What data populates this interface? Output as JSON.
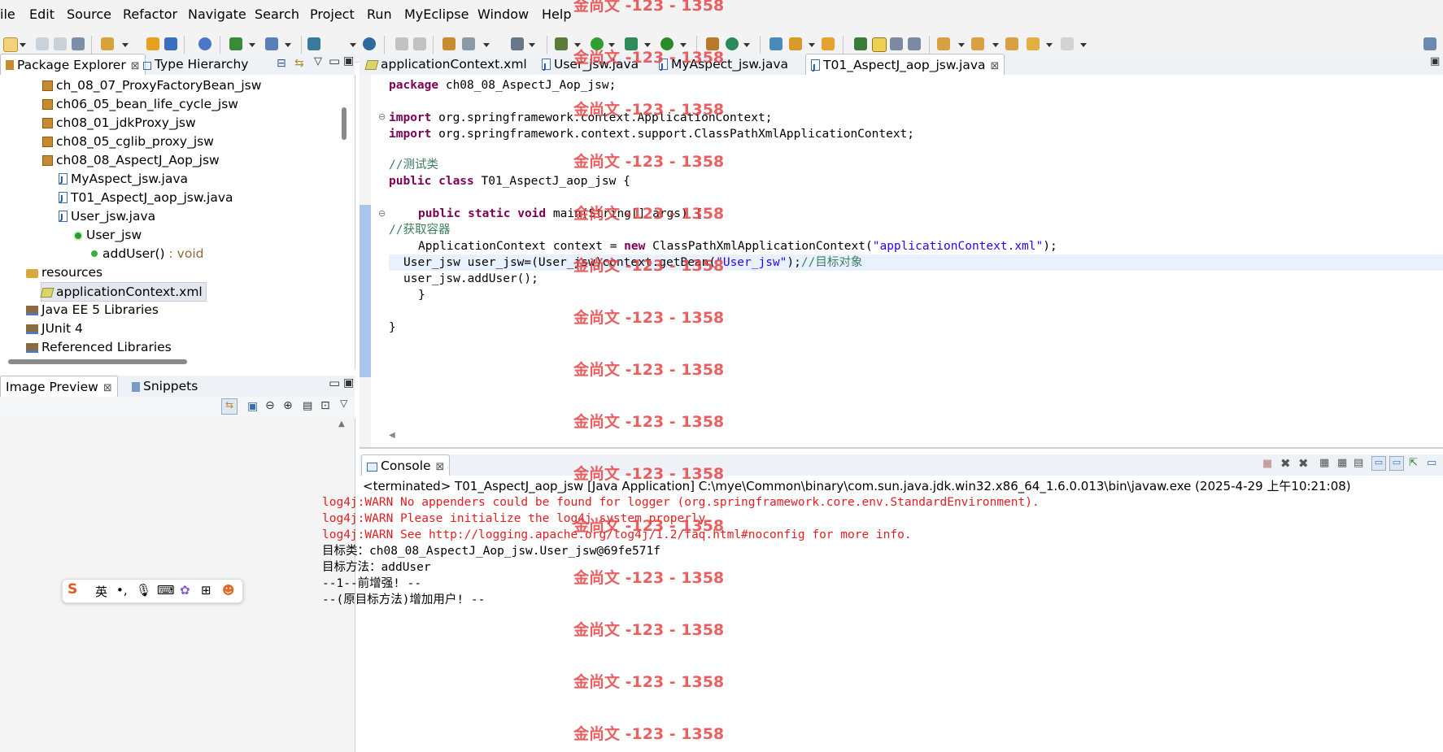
{
  "menu": [
    "ile",
    "Edit",
    "Source",
    "Refactor",
    "Navigate",
    "Search",
    "Project",
    "Run",
    "MyEclipse",
    "Window",
    "Help"
  ],
  "package_explorer": {
    "tabs": [
      "Package Explorer",
      "Type Hierarchy"
    ],
    "items": [
      {
        "label": "ch_08_07_ProxyFactoryBean_jsw",
        "icon": "package-icon"
      },
      {
        "label": "ch06_05_bean_life_cycle_jsw",
        "icon": "package-icon"
      },
      {
        "label": "ch08_01_jdkProxy_jsw",
        "icon": "package-icon"
      },
      {
        "label": "ch08_05_cglib_proxy_jsw",
        "icon": "package-icon"
      },
      {
        "label": "ch08_08_AspectJ_Aop_jsw",
        "icon": "package-icon"
      },
      {
        "label": "MyAspect_jsw.java",
        "icon": "java-file-icon"
      },
      {
        "label": "T01_AspectJ_aop_jsw.java",
        "icon": "java-file-icon"
      },
      {
        "label": "User_jsw.java",
        "icon": "java-file-icon"
      },
      {
        "label": "User_jsw",
        "icon": "class-icon"
      },
      {
        "label": "addUser()",
        "suffix": " : void",
        "icon": "method-icon"
      },
      {
        "label": "resources",
        "icon": "source-folder-icon"
      },
      {
        "label": "applicationContext.xml",
        "icon": "xml-file-icon"
      },
      {
        "label": "Java EE 5 Libraries",
        "icon": "library-icon"
      },
      {
        "label": "JUnit 4",
        "icon": "library-icon"
      },
      {
        "label": "Referenced Libraries",
        "icon": "library-icon"
      }
    ]
  },
  "preview": {
    "tabs": [
      "Image Preview",
      "Snippets"
    ]
  },
  "editor": {
    "tabs": [
      "applicationContext.xml",
      "User_jsw.java",
      "MyAspect_jsw.java",
      "T01_AspectJ_aop_jsw.java"
    ],
    "code": {
      "l1_kw": "package",
      "l1_rest": " ch08_08_AspectJ_Aop_jsw;",
      "l2_kw": "import",
      "l2_rest": " org.springframework.context.ApplicationContext;",
      "l3_kw": "import",
      "l3_rest": " org.springframework.context.support.ClassPathXmlApplicationContext;",
      "l4_cm": "//测试类",
      "l5_kw": "public class",
      "l5_rest": " T01_AspectJ_aop_jsw {",
      "l6_kw": "public static void",
      "l6_rest": " main(String[] args) {",
      "l7_cm": "//获取容器",
      "l8_a": "ApplicationContext context = ",
      "l8_kw": "new",
      "l8_b": " ClassPathXmlApplicationContext(",
      "l8_str": "\"applicationContext.xml\"",
      "l8_c": ");",
      "l9_a": "User_jsw user_jsw=(User_jsw)context.getBean(",
      "l9_str": "\"User_jsw\"",
      "l9_b": ");",
      "l9_cm": "//目标对象",
      "l10": "user_jsw.addUser();",
      "l11": "}",
      "l12": "}"
    }
  },
  "console": {
    "tab": "Console",
    "status": "<terminated> T01_AspectJ_aop_jsw [Java Application] C:\\mye\\Common\\binary\\com.sun.java.jdk.win32.x86_64_1.6.0.013\\bin\\javaw.exe (2025-4-29 上午10:21:08)",
    "lines": [
      {
        "text": "log4j:WARN No appenders could be found for logger (org.springframework.core.env.StandardEnvironment).",
        "err": true
      },
      {
        "text": "log4j:WARN Please initialize the log4j system properly.",
        "err": true
      },
      {
        "text": "log4j:WARN See http://logging.apache.org/log4j/1.2/faq.html#noconfig for more info.",
        "err": true
      },
      {
        "text": "目标类：ch08_08_AspectJ_Aop_jsw.User_jsw@69fe571f",
        "err": false
      },
      {
        "text": "目标方法：addUser",
        "err": false
      },
      {
        "text": "--1--前增强! --",
        "err": false
      },
      {
        "text": "--(原目标方法)增加用户! --",
        "err": false
      }
    ]
  },
  "watermark": "金尚文 -123 - 1358",
  "ime": {
    "lang": "英"
  },
  "colors": {
    "keyword": "#7f0055",
    "comment": "#3f7f5f",
    "string": "#2a00ff",
    "error": "#e02020",
    "watermark": "#e84a4a"
  }
}
